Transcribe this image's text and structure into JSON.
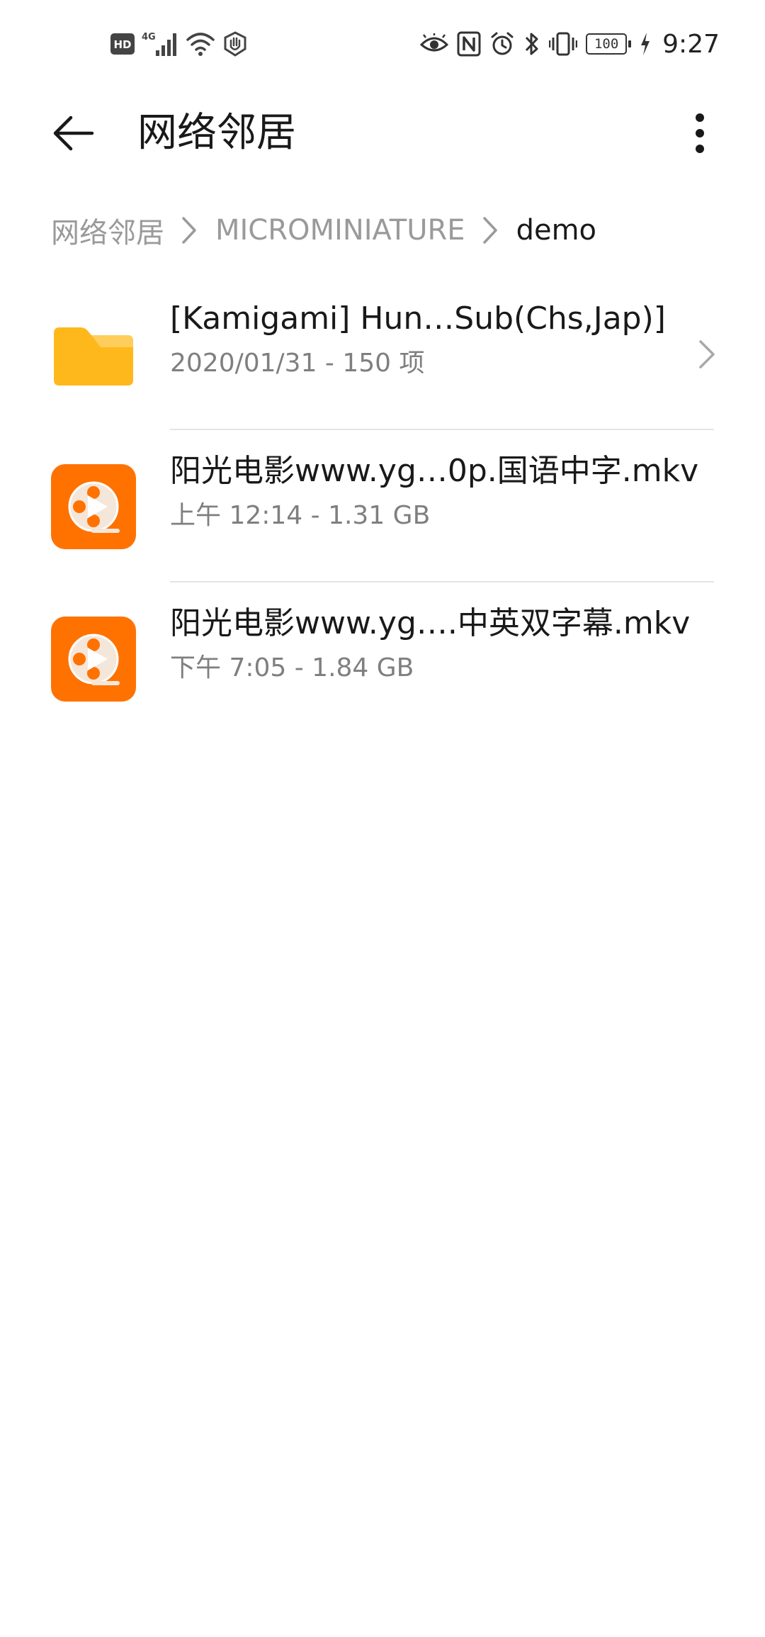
{
  "status_bar": {
    "hd_label": "HD",
    "network_label": "4G",
    "battery_level": "100",
    "time": "9:27",
    "left_icons": [
      "hd-icon",
      "signal-4g-icon",
      "wifi-icon",
      "hand-shield-icon"
    ],
    "right_icons": [
      "eye-icon",
      "nfc-icon",
      "alarm-icon",
      "bluetooth-icon",
      "vibrate-icon",
      "battery-icon",
      "charging-icon"
    ]
  },
  "app_bar": {
    "title": "网络邻居",
    "back_icon": "arrow-left-icon",
    "more_icon": "more-vertical-icon"
  },
  "breadcrumb": [
    {
      "label": "网络邻居",
      "current": false
    },
    {
      "label": "MICROMINIATURE",
      "current": false
    },
    {
      "label": "demo",
      "current": true
    }
  ],
  "files": [
    {
      "type": "folder",
      "name": "[Kamigami] Hun…Sub(Chs,Jap)]",
      "meta": "2020/01/31 - 150 项",
      "icon": "folder-icon",
      "has_chevron": true
    },
    {
      "type": "video",
      "name": "阳光电影www.yg…0p.国语中字.mkv",
      "meta": "上午 12:14  - 1.31 GB",
      "icon": "video-file-icon",
      "has_chevron": false
    },
    {
      "type": "video",
      "name": "阳光电影www.yg….中英双字幕.mkv",
      "meta": "下午 7:05  - 1.84 GB",
      "icon": "video-file-icon",
      "has_chevron": false
    }
  ],
  "colors": {
    "folder": "#FFB81C",
    "folder_tab": "#FFCF63",
    "video_bg": "#FF7200",
    "text_primary": "#191919",
    "text_secondary": "#7F7F7F",
    "breadcrumb_inactive": "#9A9A9A",
    "divider": "#E4E4E4"
  }
}
